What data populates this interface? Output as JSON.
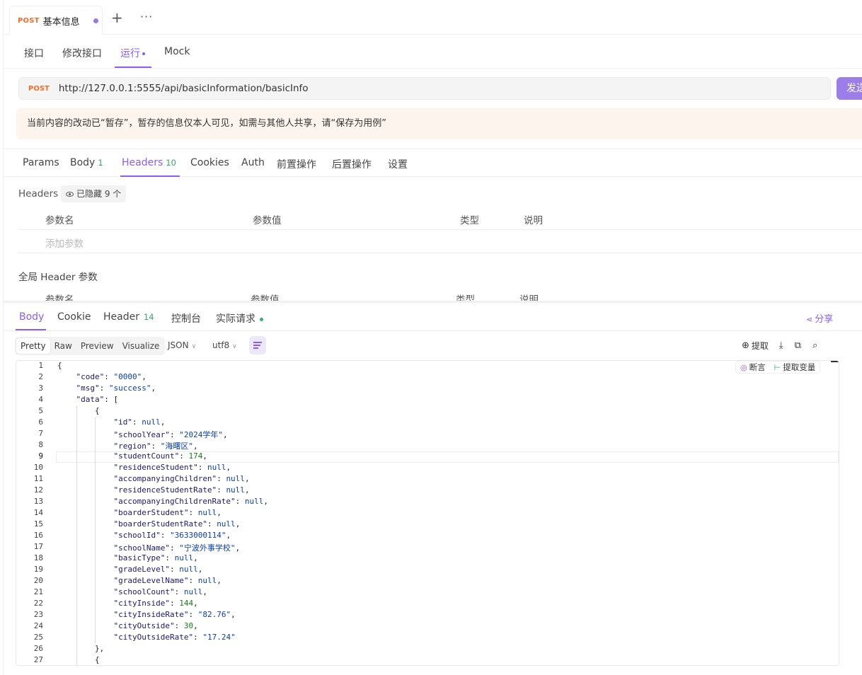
{
  "doc_tab": {
    "method": "POST",
    "title": "基本信息"
  },
  "sub_tabs": [
    "接口",
    "修改接口",
    "运行",
    "Mock"
  ],
  "request": {
    "method": "POST",
    "url": "http://127.0.0.1:5555/api/basicInformation/basicInfo",
    "send_label": "发送"
  },
  "notice": "当前内容的改动已“暂存”，暂存的信息仅本人可见，如需与其他人共享，请“保存为用例”",
  "req_tabs": {
    "params": "Params",
    "body": "Body",
    "body_count": "1",
    "headers": "Headers",
    "headers_count": "10",
    "cookies": "Cookies",
    "auth": "Auth",
    "pre": "前置操作",
    "post": "后置操作",
    "settings": "设置"
  },
  "headers_section": {
    "label": "Headers",
    "hidden": "已隐藏 9 个",
    "columns": [
      "参数名",
      "参数值",
      "类型",
      "说明"
    ],
    "add_placeholder": "添加参数",
    "global_label": "全局 Header 参数",
    "global_columns": [
      "参数名",
      "参数值",
      "类型",
      "说明"
    ]
  },
  "resp_tabs": {
    "body": "Body",
    "cookie": "Cookie",
    "header": "Header",
    "header_count": "14",
    "console": "控制台",
    "actual": "实际请求",
    "share": "分享"
  },
  "resp_toolbar": {
    "views": [
      "Pretty",
      "Raw",
      "Preview",
      "Visualize"
    ],
    "format": "JSON",
    "encoding": "utf8",
    "extract": "提取",
    "assert": "断言",
    "extract_var": "提取变量"
  },
  "code_lines": [
    "{",
    "    \"code\": \"0000\",",
    "    \"msg\": \"success\",",
    "    \"data\": [",
    "        {",
    "            \"id\": null,",
    "            \"schoolYear\": \"2024学年\",",
    "            \"region\": \"海曙区\",",
    "            \"studentCount\": 174,",
    "            \"residenceStudent\": null,",
    "            \"accompanyingChildren\": null,",
    "            \"residenceStudentRate\": null,",
    "            \"accompanyingChildrenRate\": null,",
    "            \"boarderStudent\": null,",
    "            \"boarderStudentRate\": null,",
    "            \"schoolId\": \"3633000114\",",
    "            \"schoolName\": \"宁波外事学校\",",
    "            \"basicType\": null,",
    "            \"gradeLevel\": null,",
    "            \"gradeLevelName\": null,",
    "            \"schoolCount\": null,",
    "            \"cityInside\": 144,",
    "            \"cityInsideRate\": \"82.76\",",
    "            \"cityOutside\": 30,",
    "            \"cityOutsideRate\": \"17.24\"",
    "        },",
    "        {"
  ]
}
